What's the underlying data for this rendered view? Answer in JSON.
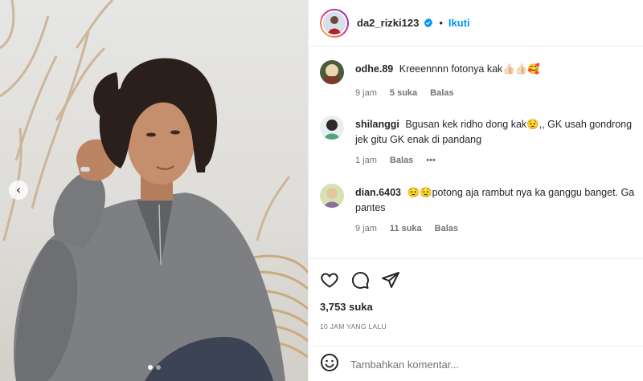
{
  "post": {
    "username": "da2_rizki123",
    "follow_label": "Ikuti",
    "separator": "•",
    "likes": "3,753 suka",
    "timestamp": "10 JAM YANG LALU",
    "comment_placeholder": "Tambahkan komentar..."
  },
  "carousel": {
    "current": 1,
    "total": 2,
    "prev_glyph": "‹"
  },
  "comments": [
    {
      "user": "odhe.89",
      "text": "Kreeennnn fotonya kak👍🏻👍🏻🥰",
      "time": "9 jam",
      "likes": "5 suka",
      "reply": "Balas",
      "more": ""
    },
    {
      "user": "shilanggi",
      "text": "Bgusan kek ridho dong kak😟,, GK usah gondrong jek gitu GK enak di pandang",
      "time": "1 jam",
      "likes": "",
      "reply": "Balas",
      "more": "•••"
    },
    {
      "user": "dian.6403",
      "text": "😟😟potong aja rambut nya ka ganggu banget. Ga pantes",
      "time": "9 jam",
      "likes": "11 suka",
      "reply": "Balas",
      "more": ""
    }
  ],
  "icons": {
    "like": "heart-icon",
    "comment": "comment-icon",
    "share": "share-icon",
    "emoji": "emoji-icon",
    "verified": "verified-badge-icon"
  },
  "colors": {
    "accent": "#0095f6",
    "meta_text": "#737373",
    "text": "#262626"
  }
}
